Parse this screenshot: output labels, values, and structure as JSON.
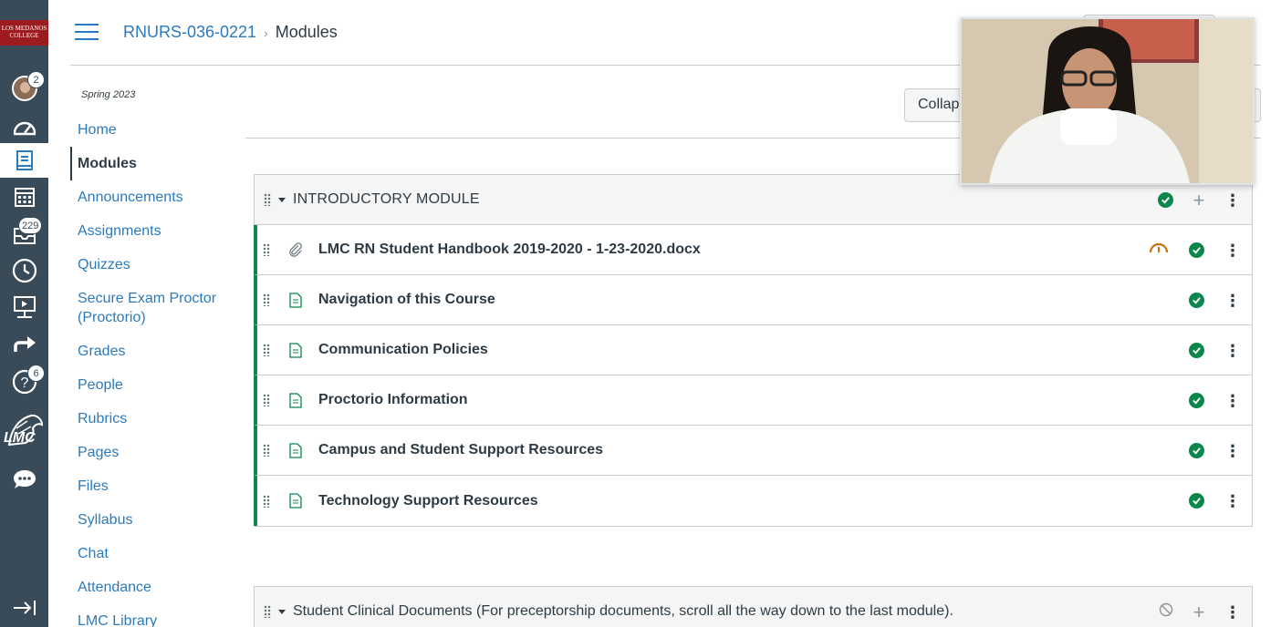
{
  "global_nav": {
    "logo_text": "LOS MEDANOS COLLEGE",
    "account_badge": "2",
    "inbox_badge": "229",
    "help_badge": "6",
    "lmc_logo_text": "LMC"
  },
  "header": {
    "course_code": "RNURS-036-0221",
    "separator": "›",
    "current_page": "Modules"
  },
  "course_nav": {
    "term": "Spring 2023",
    "items": [
      {
        "label": "Home"
      },
      {
        "label": "Modules"
      },
      {
        "label": "Announcements"
      },
      {
        "label": "Assignments"
      },
      {
        "label": "Quizzes"
      },
      {
        "label": "Secure Exam Proctor (Proctorio)"
      },
      {
        "label": "Grades"
      },
      {
        "label": "People"
      },
      {
        "label": "Rubrics"
      },
      {
        "label": "Pages"
      },
      {
        "label": "Files"
      },
      {
        "label": "Syllabus"
      },
      {
        "label": "Chat"
      },
      {
        "label": "Attendance"
      },
      {
        "label": "LMC Library"
      }
    ]
  },
  "toolbar": {
    "collapse_label": "Collaps"
  },
  "modules": [
    {
      "title": "INTRODUCTORY MODULE",
      "status": "complete",
      "items": [
        {
          "title": "LMC RN Student Handbook 2019-2020 - 1-23-2020.docx",
          "type": "attachment-icon",
          "extra": "gauge-icon"
        },
        {
          "title": "Navigation of this Course",
          "type": "page-icon"
        },
        {
          "title": "Communication Policies",
          "type": "page-icon"
        },
        {
          "title": "Proctorio Information",
          "type": "page-icon"
        },
        {
          "title": "Campus and Student Support Resources",
          "type": "page-icon"
        },
        {
          "title": "Technology Support Resources",
          "type": "page-icon"
        }
      ]
    },
    {
      "title": "Student Clinical Documents (For preceptorship documents, scroll all the way down to the last module).",
      "status": "unpublished"
    }
  ],
  "colors": {
    "link": "#2b7abc",
    "text": "#2d3b45",
    "nav_bg": "#394b58",
    "success": "#0b874b",
    "warning": "#c8720a"
  }
}
